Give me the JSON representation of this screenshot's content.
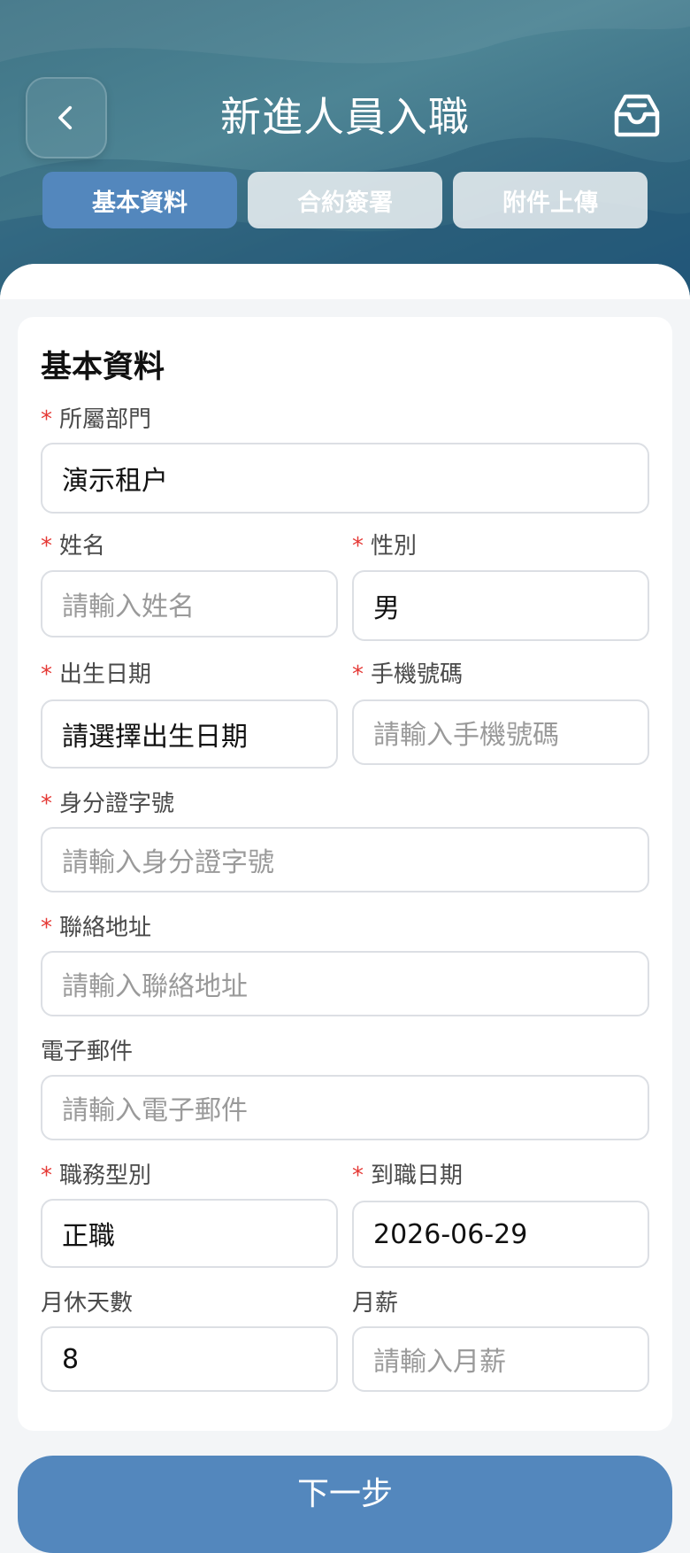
{
  "header": {
    "title": "新進人員入職",
    "back_icon": "chevron-left-icon",
    "inbox_icon": "inbox-icon"
  },
  "tabs": [
    {
      "label": "基本資料",
      "active": true
    },
    {
      "label": "合約簽署",
      "active": false
    },
    {
      "label": "附件上傳",
      "active": false
    }
  ],
  "form": {
    "title": "基本資料",
    "required_mark": "*",
    "department": {
      "label": "所屬部門",
      "value": "演示租户"
    },
    "name": {
      "label": "姓名",
      "placeholder": "請輸入姓名"
    },
    "gender": {
      "label": "性別",
      "value": "男"
    },
    "birthdate": {
      "label": "出生日期",
      "value": "請選擇出生日期"
    },
    "mobile": {
      "label": "手機號碼",
      "placeholder": "請輸入手機號碼"
    },
    "id_number": {
      "label": "身分證字號",
      "placeholder": "請輸入身分證字號"
    },
    "address": {
      "label": "聯絡地址",
      "placeholder": "請輸入聯絡地址"
    },
    "email": {
      "label": "電子郵件",
      "placeholder": "請輸入電子郵件"
    },
    "job_type": {
      "label": "職務型別",
      "value": "正職"
    },
    "start_date": {
      "label": "到職日期",
      "value": "2026-06-29"
    },
    "monthly_leave": {
      "label": "月休天數",
      "value": "8"
    },
    "salary": {
      "label": "月薪",
      "placeholder": "請輸入月薪"
    }
  },
  "footer": {
    "next_label": "下一步"
  },
  "colors": {
    "accent": "#5387bd",
    "header_bg": "#3f7486",
    "required": "#e53935"
  }
}
